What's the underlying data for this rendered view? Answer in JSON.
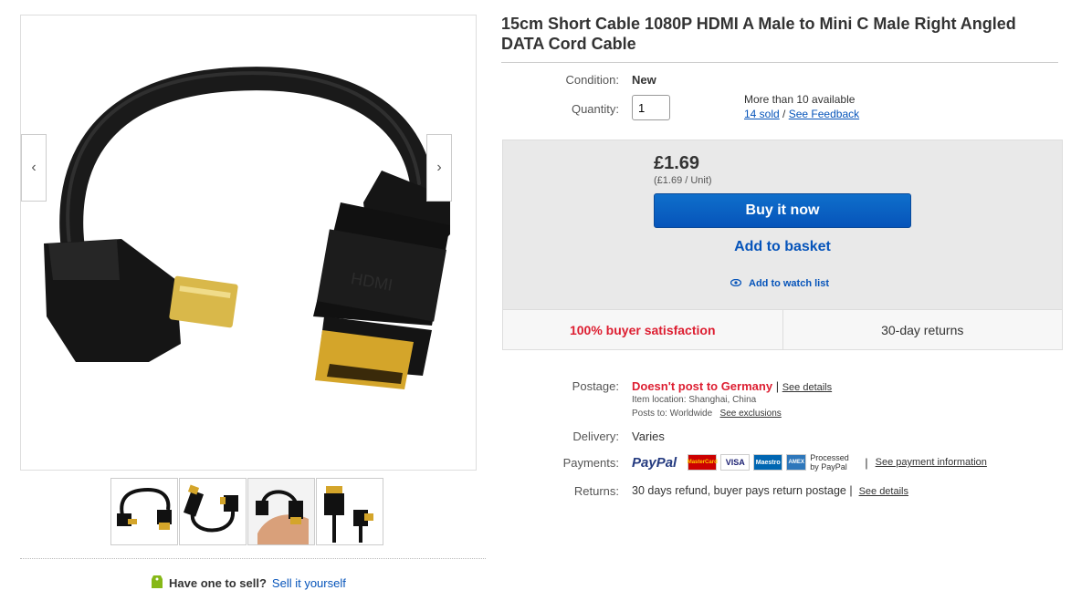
{
  "product": {
    "title": "15cm Short Cable 1080P HDMI A Male to Mini C Male Right Angled DATA Cord Cable"
  },
  "details": {
    "condition_label": "Condition:",
    "condition_value": "New",
    "quantity_label": "Quantity:",
    "quantity_value": "1",
    "available_text": "More than 10 available",
    "sold_link": "14 sold",
    "separator": "/",
    "feedback_link": "See Feedback"
  },
  "buy": {
    "price": "£1.69",
    "unit_price": "(£1.69 / Unit)",
    "buy_now_label": "Buy it now",
    "add_basket_label": "Add to basket",
    "watch_label": "Add to watch list",
    "satisfaction": "100% buyer satisfaction",
    "returns_badge": "30-day returns"
  },
  "shipping": {
    "postage_label": "Postage:",
    "postage_value": "Doesn't post to Germany",
    "postage_pipe": "|",
    "see_details": "See details",
    "item_location": "Item location:  Shanghai, China",
    "posts_to": "Posts to:  Worldwide",
    "see_exclusions": "See exclusions",
    "delivery_label": "Delivery:",
    "delivery_value": "Varies",
    "payments_label": "Payments:",
    "paypal": "PayPal",
    "card_mastercard": "MasterCard",
    "card_visa": "VISA",
    "card_maestro": "Maestro",
    "card_amex": "AMEX",
    "processed_by": "Processed by PayPal",
    "payment_pipe": "|",
    "payment_info_link": "See payment information",
    "returns_label": "Returns:",
    "returns_value": "30 days refund, buyer pays return postage",
    "returns_pipe": "|",
    "returns_details": "See details"
  },
  "sell": {
    "question": "Have one to sell?",
    "link": "Sell it yourself"
  },
  "colors": {
    "link": "#0654ba",
    "buy_button": "#0654ba",
    "alert_red": "#dd1e31",
    "paypal_blue": "#253b80"
  }
}
